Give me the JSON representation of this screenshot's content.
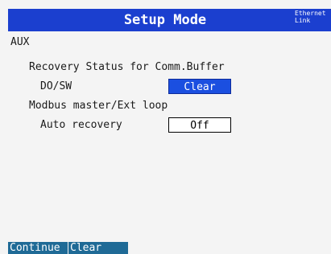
{
  "header": {
    "title": "Setup Mode",
    "status_line1": "Ethernet",
    "status_line2": "Link"
  },
  "section": {
    "label": "AUX"
  },
  "recovery": {
    "heading": "Recovery Status for Comm.Buffer",
    "do_sw_label": "DO/SW",
    "do_sw_value": "Clear"
  },
  "modbus": {
    "heading": "Modbus master/Ext loop",
    "auto_recovery_label": "Auto recovery",
    "auto_recovery_value": "Off"
  },
  "softkeys": [
    {
      "label": "Continue"
    },
    {
      "label": "Clear"
    }
  ],
  "colors": {
    "title_bar": "#1b3fcf",
    "selected_field": "#1b4fe0",
    "softkey": "#1f6a96",
    "background": "#f4f4f4"
  }
}
